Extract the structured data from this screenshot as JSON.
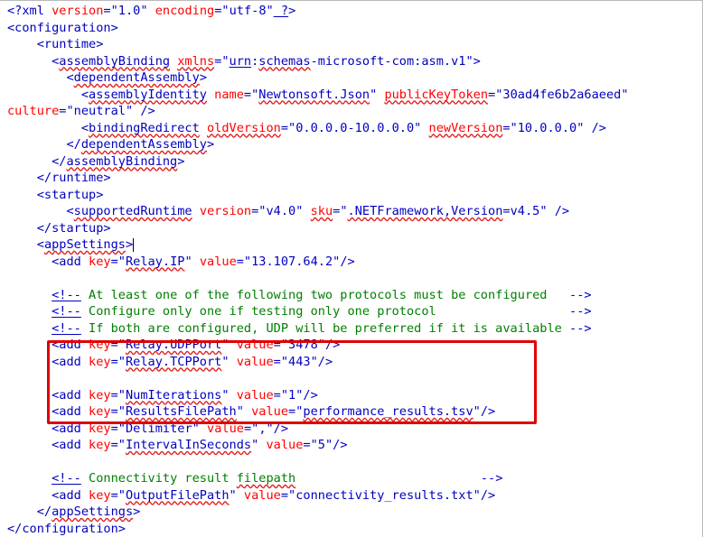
{
  "lines": [
    {
      "indent": "",
      "parts": [
        {
          "t": "<?",
          "c": "c"
        },
        {
          "t": "xml ",
          "c": "c"
        },
        {
          "t": "version",
          "c": "a"
        },
        {
          "t": "=\"",
          "c": "c"
        },
        {
          "t": "1.0",
          "c": "v"
        },
        {
          "t": "\" ",
          "c": "c"
        },
        {
          "t": "encoding",
          "c": "a"
        },
        {
          "t": "=\"",
          "c": "c"
        },
        {
          "t": "utf-8",
          "c": "v"
        },
        {
          "t": "\"",
          "c": "c"
        },
        {
          "t": " ?",
          "c": "c",
          "u": "ul"
        },
        {
          "t": ">",
          "c": "c"
        }
      ]
    },
    {
      "indent": "",
      "parts": [
        {
          "t": "<configuration>",
          "c": "c"
        }
      ]
    },
    {
      "indent": "    ",
      "parts": [
        {
          "t": "<runtime>",
          "c": "c"
        }
      ]
    },
    {
      "indent": "      ",
      "parts": [
        {
          "t": "<",
          "c": "c"
        },
        {
          "t": "assemblyBinding",
          "c": "c",
          "u": "sq"
        },
        {
          "t": " ",
          "c": "c"
        },
        {
          "t": "xmlns",
          "c": "a",
          "u": "sq"
        },
        {
          "t": "=\"",
          "c": "c"
        },
        {
          "t": "urn",
          "c": "v",
          "u": "ul"
        },
        {
          "t": ":",
          "c": "v"
        },
        {
          "t": "schemas",
          "c": "v",
          "u": "sq"
        },
        {
          "t": "-microsoft-com:asm.v1",
          "c": "v"
        },
        {
          "t": "\">",
          "c": "c"
        }
      ]
    },
    {
      "indent": "        ",
      "parts": [
        {
          "t": "<",
          "c": "c"
        },
        {
          "t": "dependentAssembly",
          "c": "c",
          "u": "sq"
        },
        {
          "t": ">",
          "c": "c"
        }
      ]
    },
    {
      "indent": "          ",
      "parts": [
        {
          "t": "<",
          "c": "c"
        },
        {
          "t": "assemblyIdentity",
          "c": "c",
          "u": "sq"
        },
        {
          "t": " ",
          "c": "c"
        },
        {
          "t": "name",
          "c": "a"
        },
        {
          "t": "=\"",
          "c": "c"
        },
        {
          "t": "Newtonsoft.Json",
          "c": "v",
          "u": "sq"
        },
        {
          "t": "\" ",
          "c": "c"
        },
        {
          "t": "publicKeyToken",
          "c": "a",
          "u": "sq"
        },
        {
          "t": "=\"",
          "c": "c"
        },
        {
          "t": "30ad4fe6b2a6aeed",
          "c": "v"
        },
        {
          "t": "\"",
          "c": "c"
        }
      ]
    },
    {
      "indent": "",
      "parts": [
        {
          "t": "culture",
          "c": "a"
        },
        {
          "t": "=\"",
          "c": "c"
        },
        {
          "t": "neutral",
          "c": "v"
        },
        {
          "t": "\" />",
          "c": "c"
        }
      ]
    },
    {
      "indent": "          ",
      "parts": [
        {
          "t": "<",
          "c": "c"
        },
        {
          "t": "bindingRedirect",
          "c": "c",
          "u": "sq"
        },
        {
          "t": " ",
          "c": "c"
        },
        {
          "t": "oldVersion",
          "c": "a",
          "u": "sq"
        },
        {
          "t": "=\"",
          "c": "c"
        },
        {
          "t": "0.0.0.0-10.0.0.0",
          "c": "v"
        },
        {
          "t": "\" ",
          "c": "c"
        },
        {
          "t": "newVersion",
          "c": "a",
          "u": "sq"
        },
        {
          "t": "=\"",
          "c": "c"
        },
        {
          "t": "10.0.0.0",
          "c": "v"
        },
        {
          "t": "\" />",
          "c": "c"
        }
      ]
    },
    {
      "indent": "        ",
      "parts": [
        {
          "t": "</",
          "c": "c"
        },
        {
          "t": "dependentAssembly",
          "c": "c",
          "u": "sq"
        },
        {
          "t": ">",
          "c": "c"
        }
      ]
    },
    {
      "indent": "      ",
      "parts": [
        {
          "t": "</",
          "c": "c"
        },
        {
          "t": "assemblyBinding",
          "c": "c",
          "u": "sq"
        },
        {
          "t": ">",
          "c": "c"
        }
      ]
    },
    {
      "indent": "    ",
      "parts": [
        {
          "t": "</runtime>",
          "c": "c"
        }
      ]
    },
    {
      "indent": "    ",
      "parts": [
        {
          "t": "<startup>",
          "c": "c"
        }
      ]
    },
    {
      "indent": "        ",
      "parts": [
        {
          "t": "<",
          "c": "c"
        },
        {
          "t": "supportedRuntime",
          "c": "c",
          "u": "sq"
        },
        {
          "t": " ",
          "c": "c"
        },
        {
          "t": "version",
          "c": "a"
        },
        {
          "t": "=\"",
          "c": "c"
        },
        {
          "t": "v4.0",
          "c": "v"
        },
        {
          "t": "\" ",
          "c": "c"
        },
        {
          "t": "sku",
          "c": "a",
          "u": "sq"
        },
        {
          "t": "=\"",
          "c": "c"
        },
        {
          "t": ".NETFramework,Version",
          "c": "v",
          "u": "sq"
        },
        {
          "t": "=v4.5",
          "c": "v"
        },
        {
          "t": "\" />",
          "c": "c"
        }
      ]
    },
    {
      "indent": "    ",
      "parts": [
        {
          "t": "</startup>",
          "c": "c"
        }
      ]
    },
    {
      "indent": "    ",
      "parts": [
        {
          "t": "<",
          "c": "c"
        },
        {
          "t": "appSettings",
          "c": "c",
          "u": "sq"
        },
        {
          "t": ">",
          "c": "c"
        }
      ],
      "caret": true
    },
    {
      "indent": "      ",
      "parts": [
        {
          "t": "<add ",
          "c": "c"
        },
        {
          "t": "key",
          "c": "a"
        },
        {
          "t": "=\"",
          "c": "c"
        },
        {
          "t": "Relay.IP",
          "c": "v",
          "u": "sq"
        },
        {
          "t": "\" ",
          "c": "c"
        },
        {
          "t": "value",
          "c": "a"
        },
        {
          "t": "=\"",
          "c": "c"
        },
        {
          "t": "13.107.64.2",
          "c": "v"
        },
        {
          "t": "\"/>",
          "c": "c"
        }
      ]
    },
    {
      "indent": "",
      "parts": []
    },
    {
      "indent": "      ",
      "parts": [
        {
          "t": "<!--",
          "c": "c",
          "u": "ul"
        },
        {
          "t": " At least one of the following two protocols must be configured   ",
          "c": "cm"
        },
        {
          "t": "-->",
          "c": "c"
        }
      ]
    },
    {
      "indent": "      ",
      "parts": [
        {
          "t": "<!--",
          "c": "c",
          "u": "ul"
        },
        {
          "t": " Configure only one if testing only one protocol                  ",
          "c": "cm"
        },
        {
          "t": "-->",
          "c": "c"
        }
      ]
    },
    {
      "indent": "      ",
      "parts": [
        {
          "t": "<!--",
          "c": "c",
          "u": "ul"
        },
        {
          "t": " If both are configured, UDP will be preferred if it is available ",
          "c": "cm"
        },
        {
          "t": "-->",
          "c": "c"
        }
      ]
    },
    {
      "indent": "      ",
      "parts": [
        {
          "t": "<add ",
          "c": "c"
        },
        {
          "t": "key",
          "c": "a"
        },
        {
          "t": "=\"",
          "c": "c"
        },
        {
          "t": "Relay.UDPPort",
          "c": "v",
          "u": "sq"
        },
        {
          "t": "\" ",
          "c": "c"
        },
        {
          "t": "value",
          "c": "a"
        },
        {
          "t": "=\"",
          "c": "c"
        },
        {
          "t": "3478",
          "c": "v"
        },
        {
          "t": "\"/>",
          "c": "c"
        }
      ]
    },
    {
      "indent": "      ",
      "parts": [
        {
          "t": "<add ",
          "c": "c"
        },
        {
          "t": "key",
          "c": "a"
        },
        {
          "t": "=\"",
          "c": "c"
        },
        {
          "t": "Relay.TCPPort",
          "c": "v",
          "u": "sq"
        },
        {
          "t": "\" ",
          "c": "c"
        },
        {
          "t": "value",
          "c": "a"
        },
        {
          "t": "=\"",
          "c": "c"
        },
        {
          "t": "443",
          "c": "v"
        },
        {
          "t": "\"/>",
          "c": "c"
        }
      ]
    },
    {
      "indent": "",
      "parts": []
    },
    {
      "indent": "      ",
      "parts": [
        {
          "t": "<add ",
          "c": "c"
        },
        {
          "t": "key",
          "c": "a"
        },
        {
          "t": "=\"",
          "c": "c"
        },
        {
          "t": "NumIterations",
          "c": "v",
          "u": "sq"
        },
        {
          "t": "\" ",
          "c": "c"
        },
        {
          "t": "value",
          "c": "a"
        },
        {
          "t": "=\"",
          "c": "c"
        },
        {
          "t": "1",
          "c": "v"
        },
        {
          "t": "\"/>",
          "c": "c"
        }
      ]
    },
    {
      "indent": "      ",
      "parts": [
        {
          "t": "<add ",
          "c": "c"
        },
        {
          "t": "key",
          "c": "a"
        },
        {
          "t": "=\"",
          "c": "c"
        },
        {
          "t": "ResultsFilePath",
          "c": "v",
          "u": "sq"
        },
        {
          "t": "\" ",
          "c": "c"
        },
        {
          "t": "value",
          "c": "a"
        },
        {
          "t": "=\"",
          "c": "c"
        },
        {
          "t": "performance_results.tsv",
          "c": "v",
          "u": "sq"
        },
        {
          "t": "\"/>",
          "c": "c"
        }
      ]
    },
    {
      "indent": "      ",
      "parts": [
        {
          "t": "<add ",
          "c": "c"
        },
        {
          "t": "key",
          "c": "a"
        },
        {
          "t": "=\"",
          "c": "c"
        },
        {
          "t": "Delimiter",
          "c": "v"
        },
        {
          "t": "\" ",
          "c": "c"
        },
        {
          "t": "value",
          "c": "a"
        },
        {
          "t": "=\"",
          "c": "c"
        },
        {
          "t": ",",
          "c": "v"
        },
        {
          "t": "\"/>",
          "c": "c"
        }
      ]
    },
    {
      "indent": "      ",
      "parts": [
        {
          "t": "<add ",
          "c": "c"
        },
        {
          "t": "key",
          "c": "a"
        },
        {
          "t": "=\"",
          "c": "c"
        },
        {
          "t": "IntervalInSeconds",
          "c": "v",
          "u": "sq"
        },
        {
          "t": "\" ",
          "c": "c"
        },
        {
          "t": "value",
          "c": "a"
        },
        {
          "t": "=\"",
          "c": "c"
        },
        {
          "t": "5",
          "c": "v"
        },
        {
          "t": "\"/>",
          "c": "c"
        }
      ]
    },
    {
      "indent": "",
      "parts": []
    },
    {
      "indent": "      ",
      "parts": [
        {
          "t": "<!--",
          "c": "c",
          "u": "ul"
        },
        {
          "t": " Connectivity result ",
          "c": "cm"
        },
        {
          "t": "filepath",
          "c": "cm",
          "u": "sq"
        },
        {
          "t": "                         ",
          "c": "cm"
        },
        {
          "t": "-->",
          "c": "c"
        }
      ]
    },
    {
      "indent": "      ",
      "parts": [
        {
          "t": "<add ",
          "c": "c"
        },
        {
          "t": "key",
          "c": "a"
        },
        {
          "t": "=\"",
          "c": "c"
        },
        {
          "t": "OutputFilePath",
          "c": "v",
          "u": "sq"
        },
        {
          "t": "\" ",
          "c": "c"
        },
        {
          "t": "value",
          "c": "a"
        },
        {
          "t": "=\"",
          "c": "c"
        },
        {
          "t": "connectivity_results.txt",
          "c": "v"
        },
        {
          "t": "\"/>",
          "c": "c"
        }
      ]
    },
    {
      "indent": "    ",
      "parts": [
        {
          "t": "</",
          "c": "c"
        },
        {
          "t": "appSettings",
          "c": "c",
          "u": "sq"
        },
        {
          "t": ">",
          "c": "c"
        }
      ]
    },
    {
      "indent": "",
      "parts": [
        {
          "t": "</configuration>",
          "c": "c"
        }
      ]
    }
  ],
  "highlight": {
    "color": "#e00000",
    "from_line": 21,
    "to_line": 25
  }
}
